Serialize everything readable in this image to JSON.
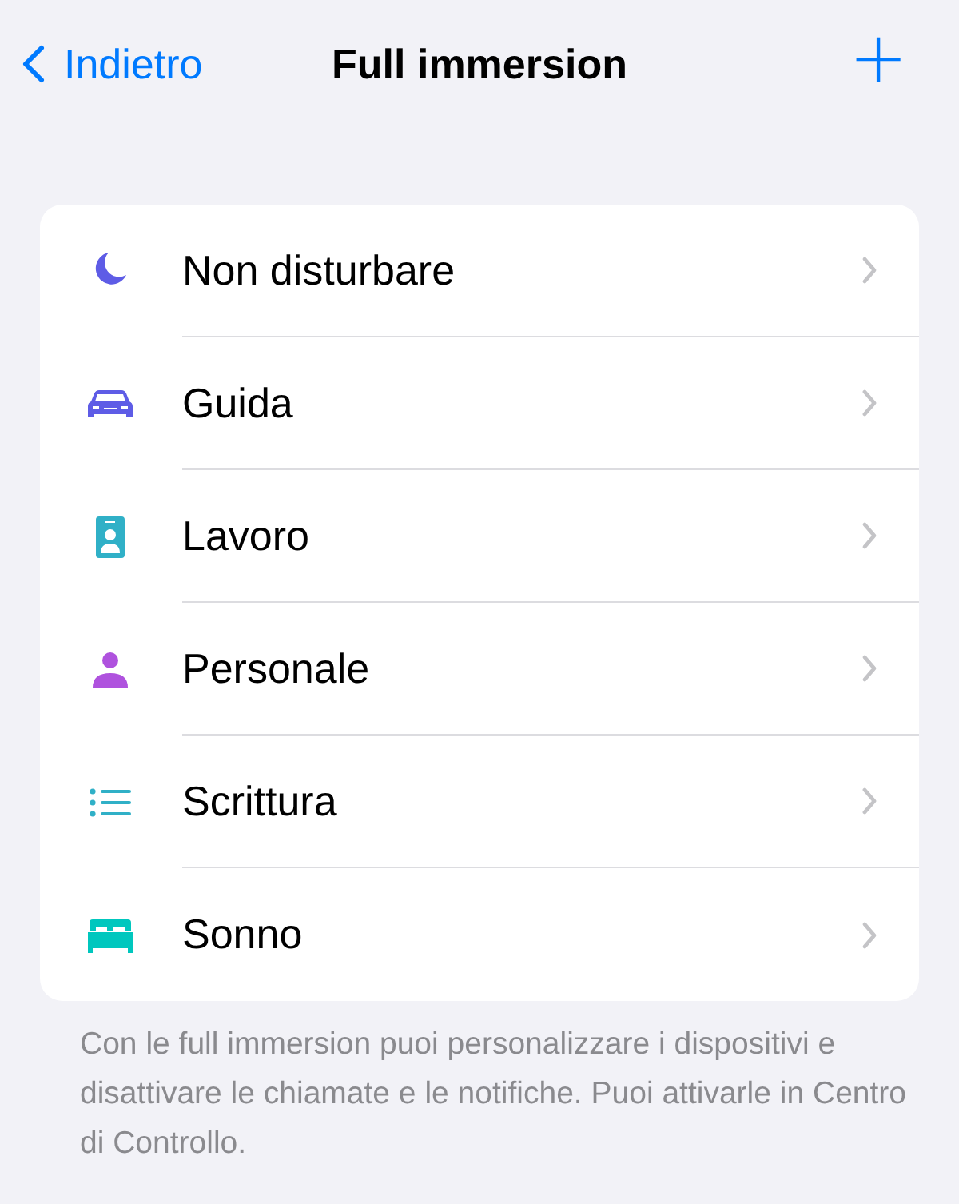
{
  "nav": {
    "back": "Indietro",
    "title": "Full immersion",
    "add": "+"
  },
  "focus_modes": [
    {
      "label": "Non disturbare",
      "kind": "moon",
      "color": "#5e5ce6"
    },
    {
      "label": "Guida",
      "kind": "car",
      "color": "#5e5ce6"
    },
    {
      "label": "Lavoro",
      "kind": "badge",
      "color": "#30b0c7"
    },
    {
      "label": "Personale",
      "kind": "person",
      "color": "#af52de"
    },
    {
      "label": "Scrittura",
      "kind": "list",
      "color": "#30b0c7"
    },
    {
      "label": "Sonno",
      "kind": "bed",
      "color": "#00c7be"
    }
  ],
  "footer": "Con le full immersion puoi personalizzare i dispositivi e disattivare le chiamate e le notifiche. Puoi attivarle in Centro di Controllo."
}
